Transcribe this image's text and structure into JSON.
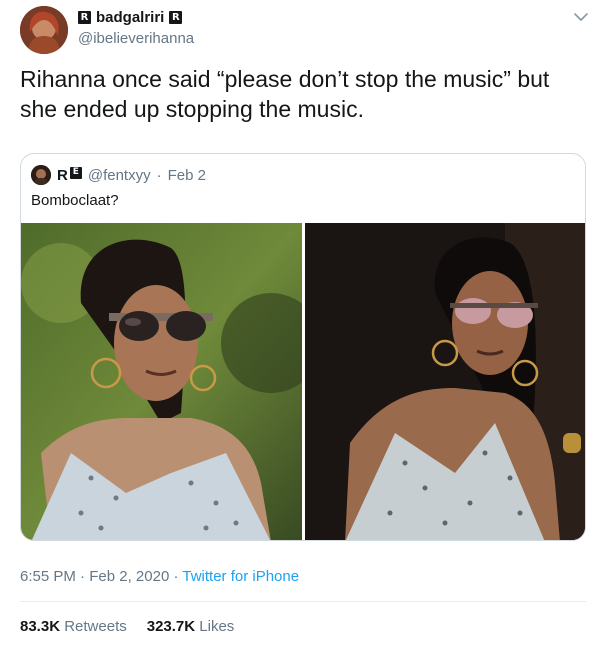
{
  "author": {
    "display_name": "badgalriri",
    "badge_letter": "R",
    "handle": "@ibelieverihanna"
  },
  "tweet": {
    "text": "Rihanna once said “please don’t stop the music” but she ended up stopping the music.",
    "time": "6:55 PM",
    "date": "Feb 2, 2020",
    "separator": "·",
    "source": "Twitter for iPhone"
  },
  "quoted": {
    "name_letters": [
      "R",
      "E"
    ],
    "handle": "@fentxyy",
    "separator": "·",
    "date": "Feb 2",
    "text": "Bomboclaat?"
  },
  "stats": {
    "retweets_value": "83.3K",
    "retweets_label": "Retweets",
    "likes_value": "323.7K",
    "likes_label": "Likes"
  },
  "icons": {
    "more": "chevron-down-icon"
  },
  "colors": {
    "link": "#1da1f2",
    "secondary_text": "#657786",
    "border": "#cfd9de"
  }
}
